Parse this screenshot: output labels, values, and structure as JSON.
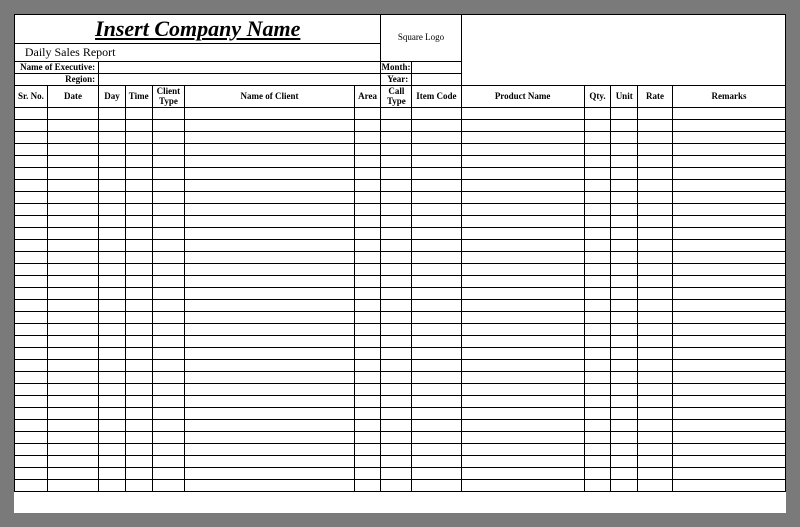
{
  "title": "Insert Company Name",
  "subtitle": "Daily Sales Report",
  "logo_label": "Square Logo",
  "meta": {
    "executive_label": "Name of Executive:",
    "region_label": "Region:",
    "month_label": "Month:",
    "year_label": "Year:"
  },
  "columns": {
    "srno": "Sr. No.",
    "date": "Date",
    "day": "Day",
    "time": "Time",
    "client_type": "Client Type",
    "name_of_client": "Name of Client",
    "area": "Area",
    "call_type": "Call Type",
    "item_code": "Item Code",
    "product_name": "Product Name",
    "qty": "Qty.",
    "unit": "Unit",
    "rate": "Rate",
    "remarks": "Remarks"
  },
  "row_count": 32
}
